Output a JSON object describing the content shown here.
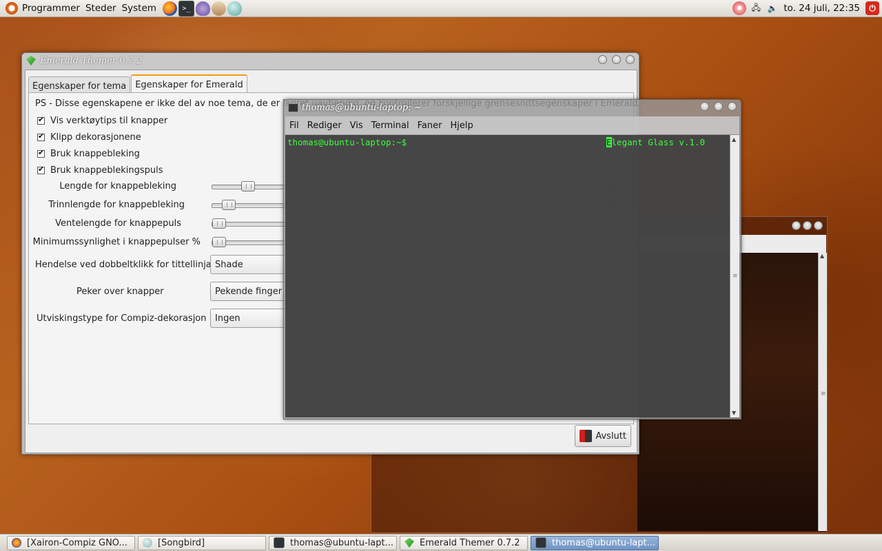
{
  "top_panel": {
    "menus": [
      "Programmer",
      "Steder",
      "System"
    ],
    "clock": "to. 24 juli, 22:35"
  },
  "emerald": {
    "title": "Emerald Themer 0.7.2",
    "tabs": [
      "Egenskaper for tema",
      "Egenskaper for Emerald"
    ],
    "info_text": "PS - Disse egenskapene er ikke del av noe tema, de er lagret uavhengig, og kontrollerer forskjellige grensesnittsegenskaper i Emerald.",
    "checkboxes": [
      "Vis verktøytips til knapper",
      "Klipp dekorasjonene",
      "Bruk knappebleking",
      "Bruk knappeblekingspuls"
    ],
    "sliders": [
      {
        "label": "Lengde for knappebleking",
        "value": "250",
        "fraction": 0.077
      },
      {
        "label": "Trinnlengde for knappebleking",
        "value": "50",
        "fraction": 0.026
      },
      {
        "label": "Ventelengde for knappepuls",
        "value": "0",
        "fraction": 0
      },
      {
        "label": "Minimumssynlighet i knappepulser %",
        "value": "0",
        "fraction": 0
      }
    ],
    "combos": [
      {
        "label": "Hendelse ved dobbeltklikk for tittellinja",
        "value": "Shade"
      },
      {
        "label": "Peker over knapper",
        "value": "Pekende finger"
      },
      {
        "label": "Utviskingstype for Compiz-dekorasjon",
        "value": "Ingen"
      }
    ],
    "quit_label": "Avslutt"
  },
  "terminal": {
    "title": "thomas@ubuntu-laptop: ~",
    "menus": [
      "Fil",
      "Rediger",
      "Vis",
      "Terminal",
      "Faner",
      "Hjelp"
    ],
    "prompt": "thomas@ubuntu-laptop:~$",
    "cursor_char": "E",
    "theme_rest": "legant Glass v.1.0"
  },
  "taskbar": [
    {
      "label": "[Xairon-Compiz GNO...",
      "icon": "firefox-icon"
    },
    {
      "label": "[Songbird]",
      "icon": "songbird-icon"
    },
    {
      "label": "thomas@ubuntu-lapt...",
      "icon": "terminal-icon"
    },
    {
      "label": "Emerald Themer 0.7.2",
      "icon": "emerald-icon"
    },
    {
      "label": "thomas@ubuntu-lapt...",
      "icon": "terminal-icon",
      "active": true
    }
  ]
}
